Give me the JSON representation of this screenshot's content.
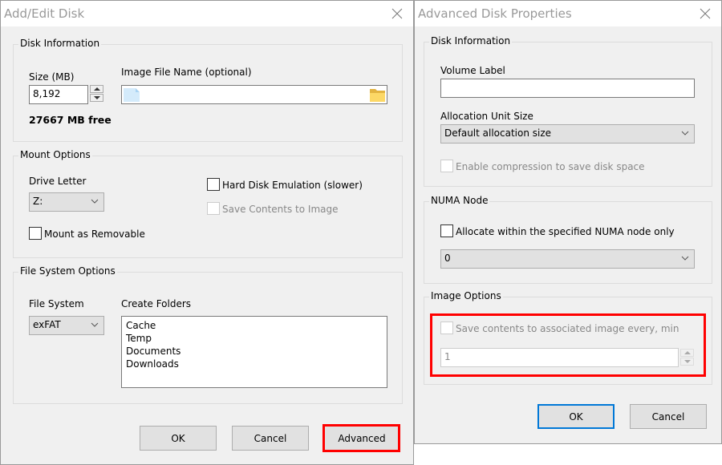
{
  "add_edit_dialog": {
    "title": "Add/Edit Disk",
    "disk_information": {
      "legend": "Disk Information",
      "size_label": "Size (MB)",
      "size_value": "8,192",
      "image_file_label": "Image File Name (optional)",
      "image_file_value": "",
      "free_space": "27667 MB free"
    },
    "mount_options": {
      "legend": "Mount Options",
      "drive_letter_label": "Drive Letter",
      "drive_letter_value": "Z:",
      "hard_disk_emulation_label": "Hard Disk Emulation (slower)",
      "hard_disk_emulation_checked": false,
      "save_contents_label": "Save Contents to Image",
      "save_contents_checked": false,
      "save_contents_enabled": false,
      "mount_removable_label": "Mount as Removable",
      "mount_removable_checked": false
    },
    "file_system_options": {
      "legend": "File System Options",
      "file_system_label": "File System",
      "file_system_value": "exFAT",
      "create_folders_label": "Create Folders",
      "folders": [
        "Cache",
        "Temp",
        "Documents",
        "Downloads"
      ]
    },
    "buttons": {
      "ok": "OK",
      "cancel": "Cancel",
      "advanced": "Advanced"
    },
    "highlighted": "Advanced"
  },
  "advanced_dialog": {
    "title": "Advanced Disk Properties",
    "disk_information": {
      "legend": "Disk Information",
      "volume_label_label": "Volume Label",
      "volume_label_value": "",
      "allocation_unit_label": "Allocation Unit Size",
      "allocation_unit_value": "Default allocation size",
      "compression_label": "Enable compression to save disk space",
      "compression_checked": false,
      "compression_enabled": false
    },
    "numa_node": {
      "legend": "NUMA Node",
      "allocate_label": "Allocate within the specified NUMA node only",
      "allocate_checked": false,
      "node_value": "0"
    },
    "image_options": {
      "legend": "Image Options",
      "save_every_label": "Save contents to associated image every, min",
      "save_every_checked": false,
      "save_every_enabled": false,
      "interval_value": "1"
    },
    "buttons": {
      "ok": "OK",
      "cancel": "Cancel"
    },
    "highlight_color": "#ff0000",
    "default_button_color": "#0078d7"
  }
}
